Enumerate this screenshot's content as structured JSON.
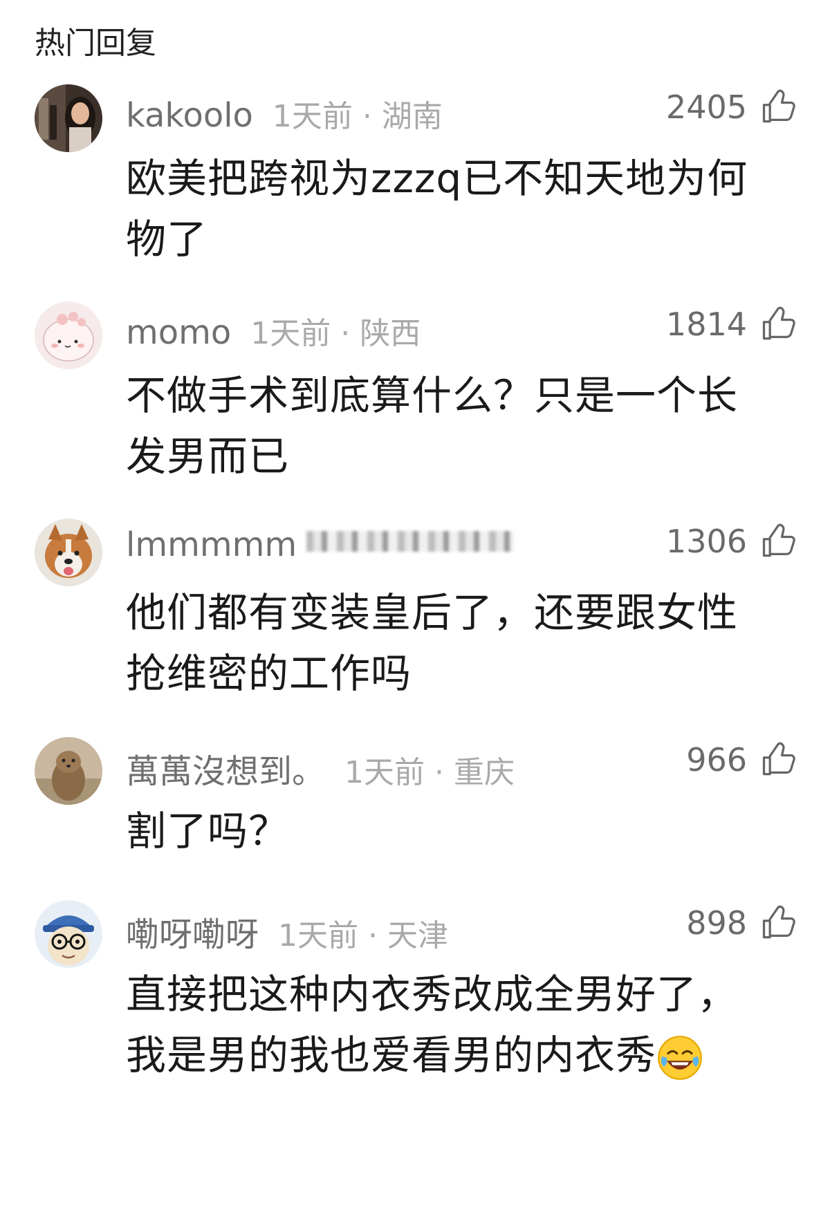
{
  "section_title": "热门回复",
  "comments": [
    {
      "username": "kakoolo",
      "time": "1天前",
      "separator": "·",
      "region": "湖南",
      "likes": "2405",
      "text": "欧美把跨视为zzzq已不知天地为何物了"
    },
    {
      "username": "momo",
      "time": "1天前",
      "separator": "·",
      "region": "陕西",
      "likes": "1814",
      "text": "不做手术到底算什么？只是一个长发男而已"
    },
    {
      "username": "lmmmmm",
      "likes": "1306",
      "text": "他们都有变装皇后了，还要跟女性抢维密的工作吗"
    },
    {
      "username": "萬萬沒想到。",
      "time": "1天前",
      "separator": "·",
      "region": "重庆",
      "likes": "966",
      "text": "割了吗？"
    },
    {
      "username": "嘞呀嘞呀",
      "time": "1天前",
      "separator": "·",
      "region": "天津",
      "likes": "898",
      "text": "直接把这种内衣秀改成全男好了，我是男的我也爱看男的内衣秀",
      "emoji": "laughing-crying-emoji"
    }
  ],
  "icons": {
    "like": "thumbs-up-icon"
  },
  "colors": {
    "username": "#6f6f6f",
    "meta": "#a9a9a9",
    "text": "#1a1a1a",
    "likes": "#6a6a6a"
  }
}
